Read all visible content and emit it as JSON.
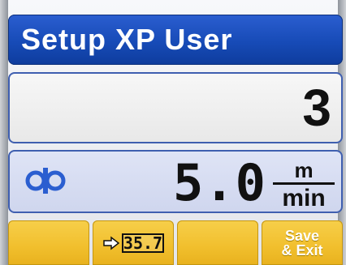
{
  "header": {
    "title": "Setup XP User"
  },
  "main": {
    "value": "3",
    "speed": {
      "icon": "spool-icon",
      "value": "5.0",
      "unit_top": "m",
      "unit_bottom": "min"
    }
  },
  "softkeys": [
    {
      "label": ""
    },
    {
      "icon": "arrow-right-icon",
      "value": "35.7"
    },
    {
      "label": ""
    },
    {
      "line1": "Save",
      "line2": "& Exit"
    }
  ],
  "colors": {
    "title_bg": "#1d50bd",
    "panel_border": "#3f5fb0",
    "softkey_bg": "#f1bf2d",
    "text_white": "#ffffff",
    "text_dark": "#111111"
  }
}
